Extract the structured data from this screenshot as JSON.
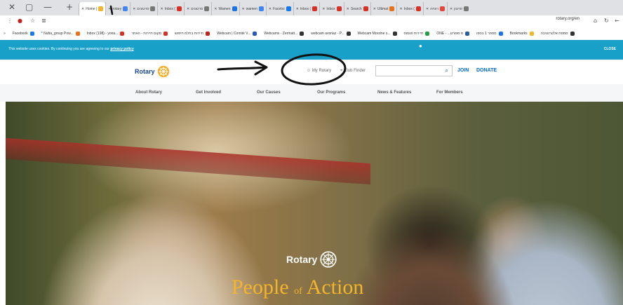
{
  "browser": {
    "tabs": [
      {
        "label": "Home |",
        "color": "#f5b52a",
        "active": true
      },
      {
        "label": "rotary",
        "color": "#4285f4"
      },
      {
        "label": "סרטונים",
        "color": "#777777"
      },
      {
        "label": "Inbox (",
        "color": "#d93025"
      },
      {
        "label": "סרטונים",
        "color": "#777777"
      },
      {
        "label": "Wamen",
        "color": "#1a73e8"
      },
      {
        "label": "wamen",
        "color": "#4285f4"
      },
      {
        "label": "Facebo",
        "color": "#1877f2"
      },
      {
        "label": "Inbox (",
        "color": "#d93025"
      },
      {
        "label": "Inbox",
        "color": "#d93025"
      },
      {
        "label": "Search",
        "color": "#d93025"
      },
      {
        "label": "Ultimat",
        "color": "#e8711a"
      },
      {
        "label": "Inbox (",
        "color": "#d93025"
      },
      {
        "label": "רווחה",
        "color": "#e8453c"
      },
      {
        "label": "סרטון",
        "color": "#777777"
      }
    ],
    "url": "rotary.org/en",
    "bookmarks": [
      {
        "label": "Facebook",
        "color": "#1877f2"
      },
      {
        "label": "* Nuba_group Pow...",
        "color": "#e8711a"
      },
      {
        "label": "Inbox (198) - yona...",
        "color": "#d93025"
      },
      {
        "label": "מקום תיירות - האתר",
        "color": "#d93025"
      },
      {
        "label": "תיירות בתלמ חיפוש",
        "color": "#c5221f"
      },
      {
        "label": "Webcam | Comité V...",
        "color": "#2a5caa"
      },
      {
        "label": "Webcams - Zermatt...",
        "color": "#333333"
      },
      {
        "label": "webcam avoriaz - P...",
        "color": "#333333"
      },
      {
        "label": "Webcam Morzine s...",
        "color": "#333333"
      },
      {
        "label": "תיירות פגסוס",
        "color": "#2a9d4b"
      },
      {
        "label": "ONE - ...ס ספורט",
        "color": "#2a5caa"
      },
      {
        "label": "מספר 1 בספו",
        "color": "#1a73e8"
      },
      {
        "label": "Bookmarks",
        "color": "#f5b52a"
      },
      {
        "label": "סמסת אלטרנטיבה",
        "color": "#333333"
      }
    ]
  },
  "cookie": {
    "text": "This website uses cookies. By continuing you are agreeing to our",
    "link": "privacy policy",
    "close": "CLOSE"
  },
  "header": {
    "logo": "Rotary",
    "my_rotary": "My Rotary",
    "club_finder": "Club Finder",
    "search_placeholder": "",
    "join": "JOIN",
    "donate": "DONATE"
  },
  "nav": {
    "items": [
      "About Rotary",
      "Get Involved",
      "Our Causes",
      "Our Programs",
      "News & Features",
      "For Members"
    ]
  },
  "hero": {
    "logo": "Rotary",
    "title_start": "People",
    "title_of": "of",
    "title_end": "Action"
  },
  "colors": {
    "brand_blue": "#17458f",
    "brand_gold": "#f7a81b",
    "cookie_bar": "#18a0c9",
    "link_blue": "#0067c8"
  }
}
